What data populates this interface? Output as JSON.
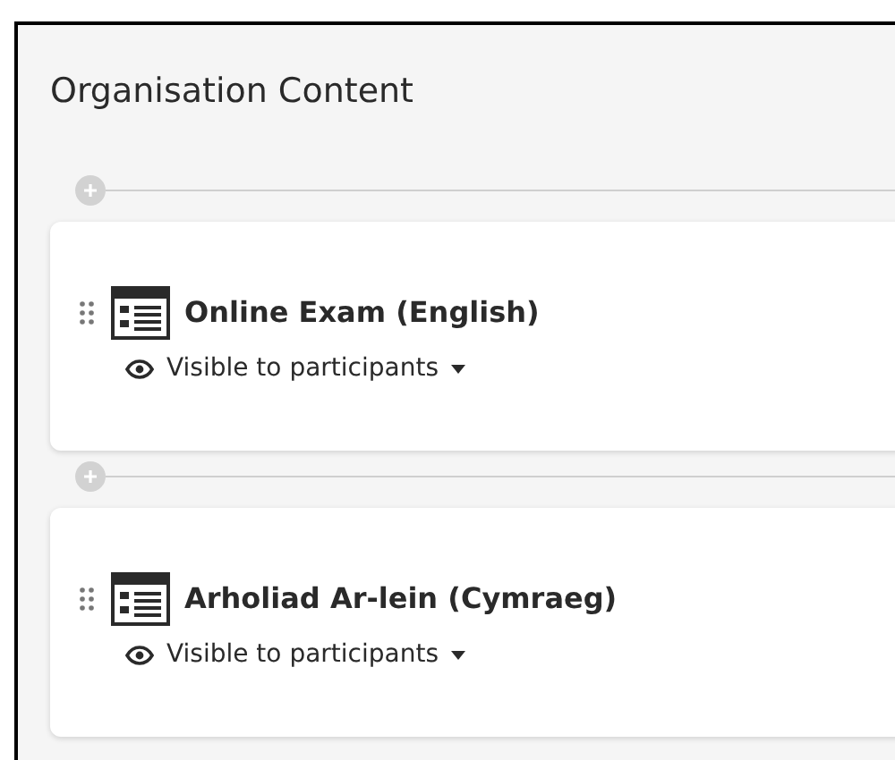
{
  "title": "Organisation Content",
  "items": [
    {
      "name": "Online Exam (English)",
      "visibility": "Visible to participants"
    },
    {
      "name": "Arholiad Ar-lein (Cymraeg)",
      "visibility": "Visible to participants"
    }
  ]
}
